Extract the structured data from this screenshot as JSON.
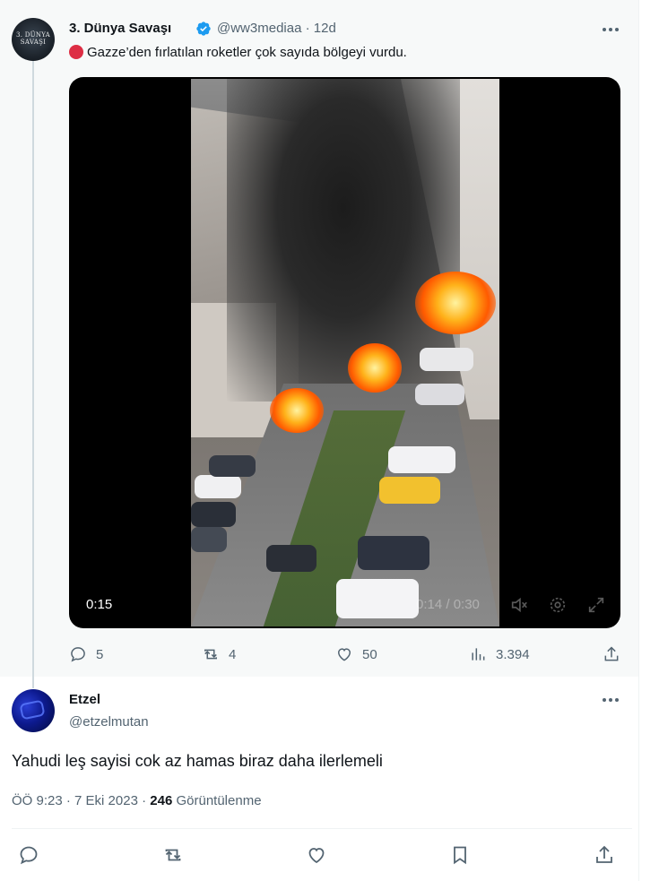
{
  "quoted_tweet": {
    "display_name": "3. Dünya Savaşı",
    "handle": "@ww3mediaa",
    "separator": "·",
    "time_ago": "12d",
    "text": "Gazze’den fırlatılan roketler çok sayıda bölgeyi vurdu.",
    "text_emoji": "red-circle",
    "avatar_text": "3. DÜNYA SAVAŞI",
    "video": {
      "elapsed": "0:15",
      "overlay_time": "0:14 / 0:30",
      "controls": [
        "mute-icon",
        "settings-icon",
        "fullscreen-icon"
      ]
    },
    "actions": {
      "replies": "5",
      "reposts": "4",
      "likes": "50",
      "views": "3.394"
    }
  },
  "reply_tweet": {
    "display_name": "Etzel",
    "handle": "@etzelmutan",
    "text": "Yahudi leş sayisi cok az hamas biraz daha ilerlemeli",
    "time": "ÖÖ 9:23",
    "date": "7 Eki 2023",
    "views_count": "246",
    "views_label": "Görüntülenme",
    "separator": "·"
  },
  "bottom_actions": [
    "reply-icon",
    "repost-icon",
    "like-icon",
    "bookmark-icon",
    "share-icon"
  ],
  "colors": {
    "verified": "#1d9bf0",
    "secondary_text": "#536471",
    "primary_text": "#0f1419",
    "quoted_bg": "#f7f9f9"
  }
}
